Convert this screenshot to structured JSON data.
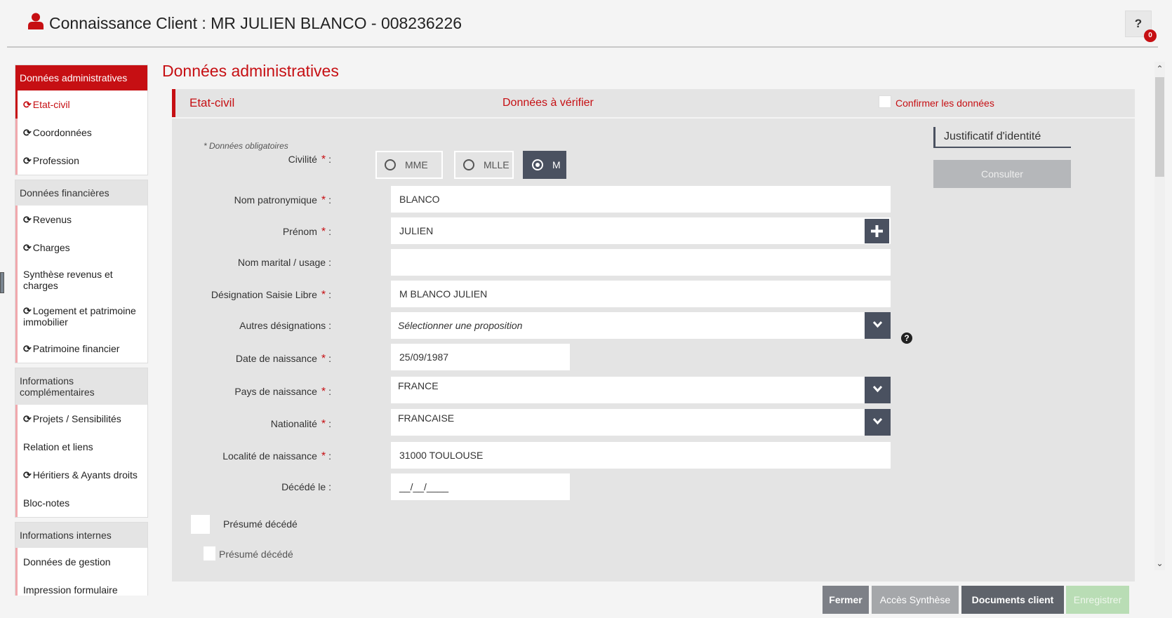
{
  "header": {
    "title": "Connaissance Client : MR JULIEN BLANCO - 008236226",
    "help_label": "?",
    "help_badge": "0"
  },
  "sidebar": {
    "groups": [
      {
        "title": "Données administratives",
        "items": [
          {
            "label": "Etat-civil",
            "refresh": true
          },
          {
            "label": "Coordonnées",
            "refresh": true
          },
          {
            "label": "Profession",
            "refresh": true
          }
        ]
      },
      {
        "title": "Données financières",
        "items": [
          {
            "label": "Revenus",
            "refresh": true
          },
          {
            "label": "Charges",
            "refresh": true
          },
          {
            "label": "Synthèse revenus et charges",
            "refresh": false
          },
          {
            "label": "Logement et patrimoine immobilier",
            "refresh": true
          },
          {
            "label": "Patrimoine financier",
            "refresh": true
          }
        ]
      },
      {
        "title": "Informations complémentaires",
        "items": [
          {
            "label": "Projets / Sensibilités",
            "refresh": true
          },
          {
            "label": "Relation et liens",
            "refresh": false
          },
          {
            "label": "Héritiers & Ayants droits",
            "refresh": true
          },
          {
            "label": "Bloc-notes",
            "refresh": false
          }
        ]
      },
      {
        "title": "Informations internes",
        "items": [
          {
            "label": "Données de gestion",
            "refresh": false
          },
          {
            "label": "Impression formulaire",
            "refresh": false
          }
        ]
      }
    ]
  },
  "main": {
    "page_title": "Données administratives",
    "section": {
      "title": "Etat-civil",
      "verify_text": "Données à vérifier",
      "confirm_label": "Confirmer les données"
    },
    "required_note": "* Données obligatoires",
    "colon": ":",
    "required_star": "*",
    "civilite": {
      "label": "Civilité",
      "options": [
        "MME",
        "MLLE",
        "M"
      ],
      "selected": "M"
    },
    "fields": {
      "nom_patronymique": {
        "label": "Nom patronymique",
        "value": "BLANCO"
      },
      "prenom": {
        "label": "Prénom",
        "value": "JULIEN"
      },
      "nom_marital": {
        "label": "Nom marital / usage",
        "value": ""
      },
      "designation": {
        "label": "Désignation Saisie Libre",
        "value": "M BLANCO JULIEN"
      },
      "autres_designations": {
        "label": "Autres désignations",
        "value": "Sélectionner une proposition"
      },
      "date_naissance": {
        "label": "Date de naissance",
        "value": "25/09/1987"
      },
      "pays_naissance": {
        "label": "Pays de naissance",
        "value": "FRANCE"
      },
      "nationalite": {
        "label": "Nationalité",
        "value": "FRANCAISE"
      },
      "localite_naissance": {
        "label": "Localité de naissance",
        "value": "31000 TOULOUSE"
      },
      "decede_le": {
        "label": "Décédé le",
        "value": "__/__/____"
      }
    },
    "presume_decede_label": "Présumé décédé",
    "presume_decede_label_2": "Présumé décédé",
    "help_icon": "?",
    "justificatif": {
      "label": "Justificatif d'identité",
      "button": "Consulter"
    }
  },
  "footer": {
    "fermer": "Fermer",
    "acces_synthese": "Accès Synthèse",
    "documents_client": "Documents client",
    "enregistrer": "Enregistrer"
  },
  "colors": {
    "accent_red": "#c60f13",
    "dark_button": "#4a5160",
    "panel_grey": "#e4e4e4",
    "save_green": "#b9ddb5"
  }
}
